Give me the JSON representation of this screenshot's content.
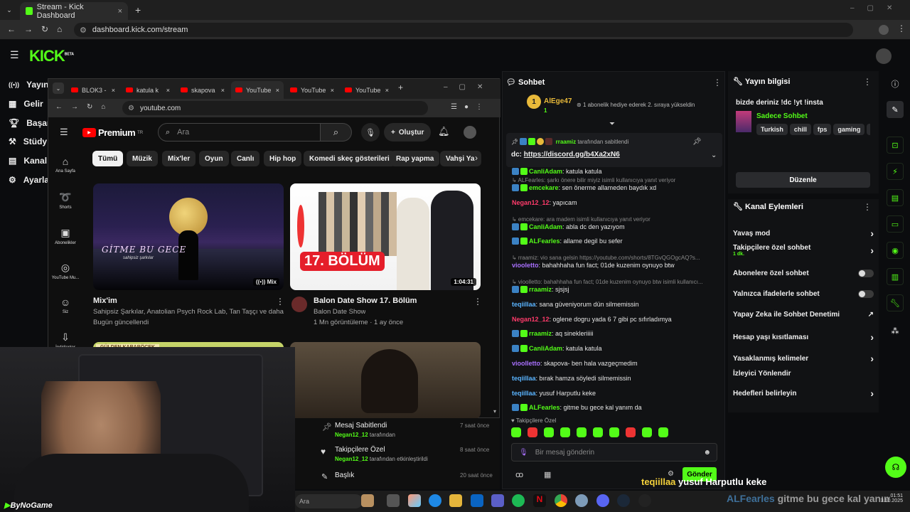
{
  "outer_tab": {
    "title": "Stream - Kick Dashboard",
    "close": "×",
    "new": "+"
  },
  "outer_url": "dashboard.kick.com/stream",
  "kick": {
    "logo": "KICK",
    "beta": "BETA",
    "nav": [
      "Yayın",
      "Gelir",
      "Başarı",
      "Stüdy",
      "Kanal",
      "Ayarla"
    ]
  },
  "inner_tabs": [
    {
      "label": "BLOK3 -"
    },
    {
      "label": "katula k"
    },
    {
      "label": "skapova"
    },
    {
      "label": "YouTube"
    },
    {
      "label": "YouTube"
    },
    {
      "label": "YouTube"
    }
  ],
  "inner_url": "youtube.com",
  "yt": {
    "logo": "Premium",
    "tr": "TR",
    "search_placeholder": "Ara",
    "create": "Oluştur",
    "chips": [
      "Tümü",
      "Müzik",
      "Mix'ler",
      "Oyun",
      "Canlı",
      "Hip hop",
      "Komedi skeç gösterileri",
      "Rap yapma",
      "Vahşi Ya"
    ],
    "side": [
      "Ana Sayfa",
      "Shorts",
      "Abonelikler",
      "YouTube Mu...",
      "Siz",
      "İndirilenler"
    ],
    "v1": {
      "title": "Mix'im",
      "sub": "Sahipsiz Şarkılar, Anatolian Psych Rock Lab, Tan Taşçı ve daha ...",
      "meta": "Bugün güncellendi",
      "thumb_text": "GİTME BU GECE",
      "thumb_sub": "sahipsiz şarkılar",
      "badge": "Mix"
    },
    "v2": {
      "title": "Balon Date Show 17. Bölüm",
      "channel": "Balon Date Show",
      "meta": "1 Mn görüntüleme · 1 ay önce",
      "thumb_text": "17. BÖLÜM",
      "duration": "1:04:31"
    },
    "v3": {
      "thumb_text": "GÜLDEN KARABÖCEK"
    }
  },
  "pinned": [
    {
      "title": "Mesaj Sabitlendi",
      "user": "Negan12_12",
      "suffix": " tarafından",
      "time": "7 saat önce"
    },
    {
      "title": "Takipçilere Özel",
      "user": "Negan12_12",
      "suffix": " tarafından etkinleştirildi",
      "time": "8 saat önce"
    },
    {
      "title": "Başlık",
      "user": "",
      "suffix": "",
      "time": "20 saat önce"
    }
  ],
  "chat": {
    "title": "Sohbet",
    "top_user": "AlEge47",
    "top_rank": "1",
    "top_count": "1",
    "sub_text": "1 abonelik hediye ederek 2. sıraya yükseldin",
    "pinned_by": "rraamiz",
    "pinned_suffix": "tarafından sabitlendi",
    "pinned_msg_prefix": "dc: ",
    "pinned_link": "https://discord.gg/b4Xa2xN6",
    "messages": [
      {
        "type": "msg",
        "user": "CanliAdam",
        "color": "#53fc18",
        "text": ": katula katula",
        "cut": true
      },
      {
        "type": "reply",
        "text": "↳ ALFearles: şarkı önere bilir miyiz isimli kullanıcıya yanıt veriyor"
      },
      {
        "type": "msg",
        "user": "emcekare",
        "color": "#53fc18",
        "text": ": sen önerme allameden baydık xd"
      },
      {
        "type": "msg",
        "user": "Negan12_12",
        "color": "#ff3b6b",
        "text": ": yapıcam"
      },
      {
        "type": "reply",
        "text": "↳ emcekare: ara madem isimli kullanıcıya yanıt veriyor"
      },
      {
        "type": "msg",
        "user": "CanliAdam",
        "color": "#53fc18",
        "text": ": abla dc den yazıyom"
      },
      {
        "type": "msg",
        "user": "ALFearles",
        "color": "#53fc18",
        "text": ": allame degil bu sefer"
      },
      {
        "type": "reply",
        "text": "↳ rraamiz: vio sana gelsin https://youtube.com/shorts/8TGvQGOgcAQ?s..."
      },
      {
        "type": "msg",
        "user": "viooletto",
        "color": "#a970ff",
        "text": ": bahahhaha fun fact; 01de kuzenim oynuyo btw"
      },
      {
        "type": "reply",
        "text": "↳ vioolletto: bahahhaha fun fact; 01de kuzenim oynuyo btw isimli kullanıcı..."
      },
      {
        "type": "msg",
        "user": "rraamiz",
        "color": "#53fc18",
        "text": ": sjsjsj"
      },
      {
        "type": "msg",
        "user": "teqiillaa",
        "color": "#5ab4ff",
        "text": ": sana güveniyorum dün silmemissin"
      },
      {
        "type": "msg",
        "user": "Negan12_12",
        "color": "#ff3b6b",
        "text": ": oglene dogru yada 6 7 gibi pc sıfırladımya"
      },
      {
        "type": "msg",
        "user": "rraamiz",
        "color": "#53fc18",
        "text": ": aq sinekleriiiii"
      },
      {
        "type": "msg",
        "user": "CanliAdam",
        "color": "#53fc18",
        "text": ": katula katula"
      },
      {
        "type": "msg",
        "user": "vioolletto",
        "color": "#a970ff",
        "text": ": skapova- ben hala vazgeçmedim"
      },
      {
        "type": "msg",
        "user": "teqiillaa",
        "color": "#5ab4ff",
        "text": ": bırak hamza söyledi silmemissin"
      },
      {
        "type": "msg",
        "user": "teqiillaa",
        "color": "#5ab4ff",
        "text": ": yusuf Harputlu keke"
      },
      {
        "type": "msg",
        "user": "ALFearles",
        "color": "#53fc18",
        "text": ": gitme bu gece kal yanım da"
      }
    ],
    "followers_only": "Takipçilere Özel",
    "input_placeholder": "Bir mesaj gönderin",
    "send": "Gönder"
  },
  "info": {
    "title": "Yayın bilgisi",
    "stream_title": "bizde deriniz !dc !yt !insta",
    "category": "Sadece Sohbet",
    "tags": [
      "Turkish",
      "chill",
      "fps",
      "gaming",
      "fu"
    ],
    "edit": "Düzenle"
  },
  "actions": {
    "title": "Kanal Eylemleri",
    "items": [
      {
        "label": "Yavaş mod",
        "kind": "arrow"
      },
      {
        "label": "Takipçilere özel sohbet",
        "sub": "1 dk.",
        "kind": "arrow"
      },
      {
        "label": "Abonelere özel sohbet",
        "kind": "toggle"
      },
      {
        "label": "Yalnızca ifadelerle sohbet",
        "kind": "toggle"
      },
      {
        "label": "Yapay Zeka ile Sohbet Denetimi",
        "kind": "ext"
      },
      {
        "label": "Hesap yaşı kısıtlaması",
        "kind": "arrow"
      },
      {
        "label": "Yasaklanmış kelimeler",
        "kind": "arrow"
      },
      {
        "label": "İzleyici Yönlendir",
        "kind": "none"
      },
      {
        "label": "Hedefleri belirleyin",
        "kind": "arrow"
      }
    ]
  },
  "overlay": {
    "user1": "teqiillaa",
    "msg1": "yusuf Harputlu keke",
    "user2": "ALFearles",
    "msg2": "gitme bu gece kal yanım da",
    "watermark": "ByNoGame"
  },
  "taskbar": {
    "search": "Ara",
    "time": "01:51",
    "date": "3.10.2025"
  },
  "colors": {
    "kick_green": "#53fc18",
    "yt_red": "#ff0000"
  }
}
